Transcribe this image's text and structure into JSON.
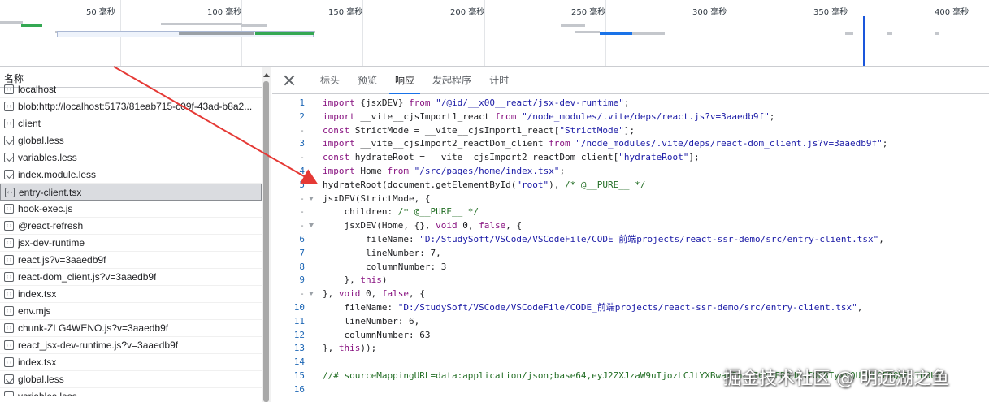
{
  "timeline": {
    "ticks": [
      {
        "label": "50 毫秒"
      },
      {
        "label": "100 毫秒"
      },
      {
        "label": "150 毫秒"
      },
      {
        "label": "200 毫秒"
      },
      {
        "label": "250 毫秒"
      },
      {
        "label": "300 毫秒"
      },
      {
        "label": "350 毫秒"
      },
      {
        "label": "400 毫秒"
      }
    ]
  },
  "list": {
    "header": "名称",
    "rows": [
      {
        "label": "localhost",
        "icon": "document-icon"
      },
      {
        "label": "blob:http://localhost:5173/81eab715-c09f-43ad-b8a2...",
        "icon": "script-icon"
      },
      {
        "label": "client",
        "icon": "script-icon"
      },
      {
        "label": "global.less",
        "icon": "stylesheet-icon"
      },
      {
        "label": "variables.less",
        "icon": "stylesheet-icon"
      },
      {
        "label": "index.module.less",
        "icon": "stylesheet-icon"
      },
      {
        "label": "entry-client.tsx",
        "icon": "script-icon",
        "selected": true
      },
      {
        "label": "hook-exec.js",
        "icon": "script-icon"
      },
      {
        "label": "@react-refresh",
        "icon": "script-icon"
      },
      {
        "label": "jsx-dev-runtime",
        "icon": "script-icon"
      },
      {
        "label": "react.js?v=3aaedb9f",
        "icon": "script-icon"
      },
      {
        "label": "react-dom_client.js?v=3aaedb9f",
        "icon": "script-icon"
      },
      {
        "label": "index.tsx",
        "icon": "script-icon"
      },
      {
        "label": "env.mjs",
        "icon": "script-icon"
      },
      {
        "label": "chunk-ZLG4WENO.js?v=3aaedb9f",
        "icon": "script-icon"
      },
      {
        "label": "react_jsx-dev-runtime.js?v=3aaedb9f",
        "icon": "script-icon"
      },
      {
        "label": "index.tsx",
        "icon": "script-icon"
      },
      {
        "label": "global.less",
        "icon": "stylesheet-icon"
      },
      {
        "label": "variables.less",
        "icon": "stylesheet-icon"
      }
    ]
  },
  "tabs": {
    "items": [
      {
        "label": "标头"
      },
      {
        "label": "预览"
      },
      {
        "label": "响应",
        "active": true
      },
      {
        "label": "发起程序"
      },
      {
        "label": "计时"
      }
    ]
  },
  "code": {
    "lines": [
      {
        "num": "1",
        "text": "import {jsxDEV} from \"/@id/__x00__react/jsx-dev-runtime\";"
      },
      {
        "num": "2",
        "text": "import __vite__cjsImport1_react from \"/node_modules/.vite/deps/react.js?v=3aaedb9f\";"
      },
      {
        "num": "-",
        "text": "const StrictMode = __vite__cjsImport1_react[\"StrictMode\"];"
      },
      {
        "num": "3",
        "text": "import __vite__cjsImport2_reactDom_client from \"/node_modules/.vite/deps/react-dom_client.js?v=3aaedb9f\";"
      },
      {
        "num": "-",
        "text": "const hydrateRoot = __vite__cjsImport2_reactDom_client[\"hydrateRoot\"];"
      },
      {
        "num": "4",
        "text": "import Home from \"/src/pages/home/index.tsx\";"
      },
      {
        "num": "5",
        "text": "hydrateRoot(document.getElementById(\"root\"), /* @__PURE__ */"
      },
      {
        "num": "-",
        "text": "jsxDEV(StrictMode, {",
        "fold": true
      },
      {
        "num": "-",
        "text": "    children: /* @__PURE__ */"
      },
      {
        "num": "-",
        "text": "    jsxDEV(Home, {}, void 0, false, {",
        "fold": true
      },
      {
        "num": "6",
        "text": "        fileName: \"D:/StudySoft/VSCode/VSCodeFile/CODE_前端projects/react-ssr-demo/src/entry-client.tsx\","
      },
      {
        "num": "7",
        "text": "        lineNumber: 7,"
      },
      {
        "num": "8",
        "text": "        columnNumber: 3"
      },
      {
        "num": "9",
        "text": "    }, this)"
      },
      {
        "num": "-",
        "text": "}, void 0, false, {",
        "fold": true
      },
      {
        "num": "10",
        "text": "    fileName: \"D:/StudySoft/VSCode/VSCodeFile/CODE_前端projects/react-ssr-demo/src/entry-client.tsx\","
      },
      {
        "num": "11",
        "text": "    lineNumber: 6,"
      },
      {
        "num": "12",
        "text": "    columnNumber: 63"
      },
      {
        "num": "13",
        "text": "}, this));"
      },
      {
        "num": "14",
        "text": ""
      },
      {
        "num": "15",
        "text": "//# sourceMappingURL=data:application/json;base64,eyJ2ZXJzaW9uIjozLCJtYXBwaW5ncyI6IkFBQUEsT0FBTyxVQUFVLGFBQWEsTU0U0"
      },
      {
        "num": "16",
        "text": ""
      }
    ]
  },
  "watermark": "掘金技术社区 @ 明远湖之鱼",
  "colors": {
    "accent": "#1a73e8",
    "annotation_arrow": "#e53935"
  }
}
